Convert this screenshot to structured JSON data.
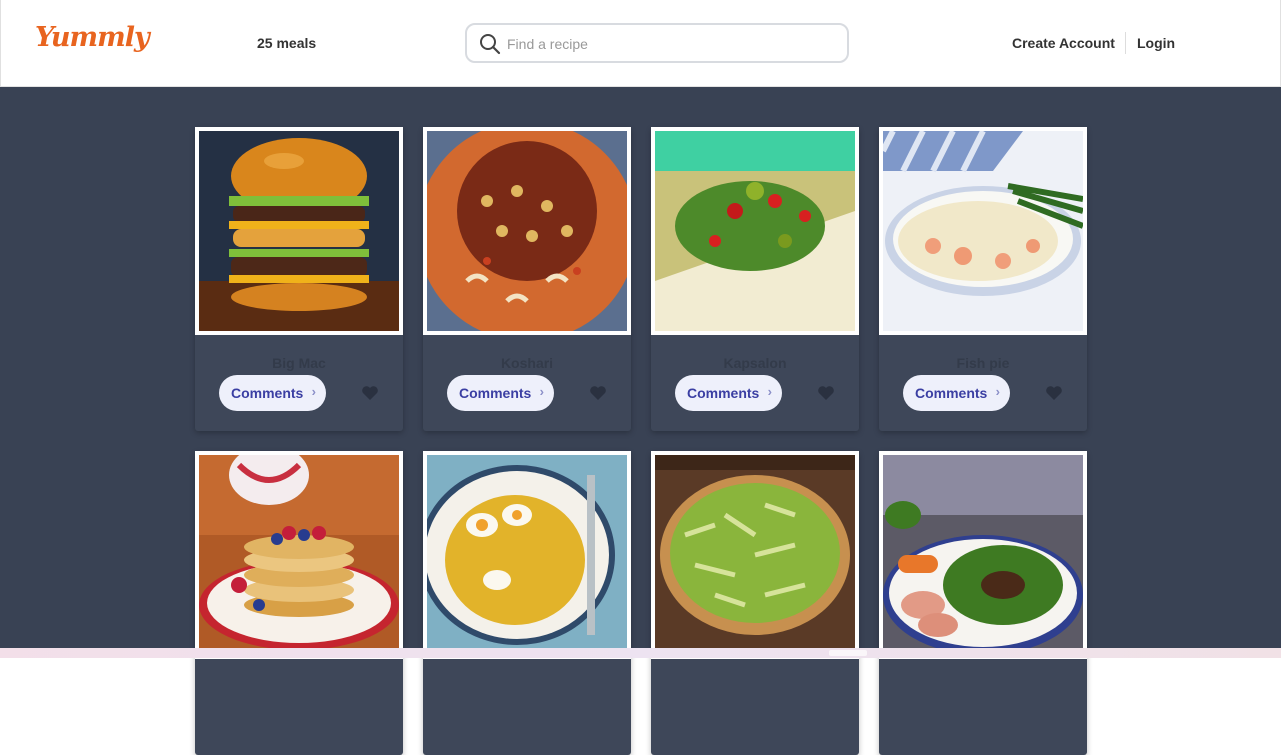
{
  "header": {
    "logo": "Yummly",
    "meal_count": "25 meals",
    "search_placeholder": "Find a recipe",
    "create_account": "Create Account",
    "login": "Login"
  },
  "colors": {
    "brand": "#e8641f",
    "background": "#394254",
    "card": "#3e4759",
    "comments_button": "#eef0fb"
  },
  "meals": [
    {
      "name": "Big Mac",
      "comments_label": "Comments",
      "icon": "heart-icon"
    },
    {
      "name": "Koshari",
      "comments_label": "Comments",
      "icon": "heart-icon"
    },
    {
      "name": "Kapsalon",
      "comments_label": "Comments",
      "icon": "heart-icon"
    },
    {
      "name": "Fish pie",
      "comments_label": "Comments",
      "icon": "heart-icon"
    },
    {
      "name": "",
      "comments_label": "",
      "icon": ""
    },
    {
      "name": "",
      "comments_label": "",
      "icon": ""
    },
    {
      "name": "",
      "comments_label": "",
      "icon": ""
    },
    {
      "name": "",
      "comments_label": "",
      "icon": ""
    }
  ]
}
